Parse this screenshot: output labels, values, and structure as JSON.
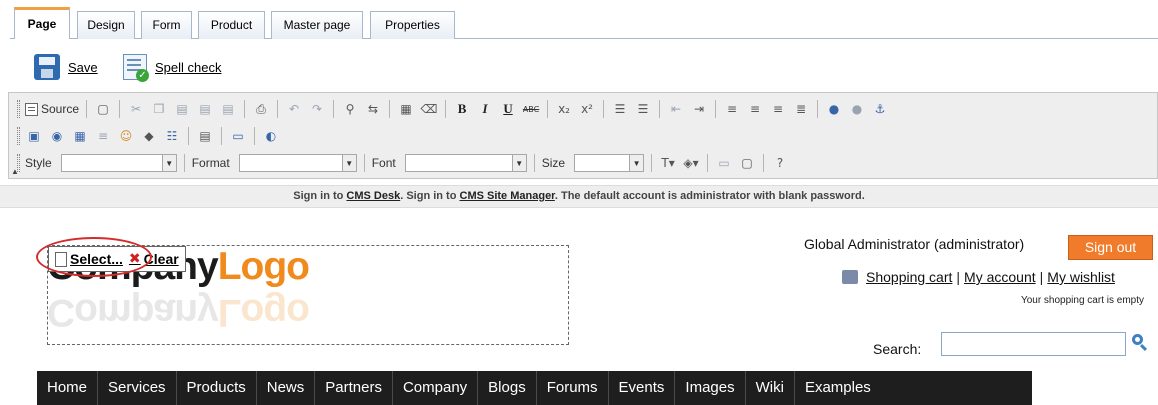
{
  "tabs": [
    "Page",
    "Design",
    "Form",
    "Product",
    "Master page",
    "Properties"
  ],
  "actions": {
    "save_label": "Save",
    "spell_label": "Spell check"
  },
  "toolbar": {
    "source_label": "Source",
    "style_label": "Style",
    "format_label": "Format",
    "font_label": "Font",
    "size_label": "Size"
  },
  "notice": {
    "part1": "Sign in to ",
    "cms_desk": "CMS Desk",
    "part2": ". Sign in to ",
    "site_manager": "CMS Site Manager",
    "part3": ". The default account is administrator with blank password."
  },
  "logo": {
    "company": "Company",
    "logo": "Logo"
  },
  "logo_selector": {
    "select_label": "Select...",
    "clear_label": "Clear"
  },
  "user": {
    "name": "Global Administrator (administrator)",
    "signout_label": "Sign out"
  },
  "links": {
    "cart": "Shopping cart",
    "account": "My account",
    "wishlist": "My wishlist",
    "separator": "|"
  },
  "cart_status": "Your shopping cart is empty",
  "search": {
    "label": "Search:",
    "value": ""
  },
  "menu": [
    "Home",
    "Services",
    "Products",
    "News",
    "Partners",
    "Company",
    "Blogs",
    "Forums",
    "Events",
    "Images",
    "Wiki",
    "Examples"
  ],
  "colors": {
    "accent": "#f07b2a",
    "menu_bg": "#1e1e1e",
    "logo_orange": "#f18a1c",
    "highlight_ring": "#d42b2b"
  }
}
